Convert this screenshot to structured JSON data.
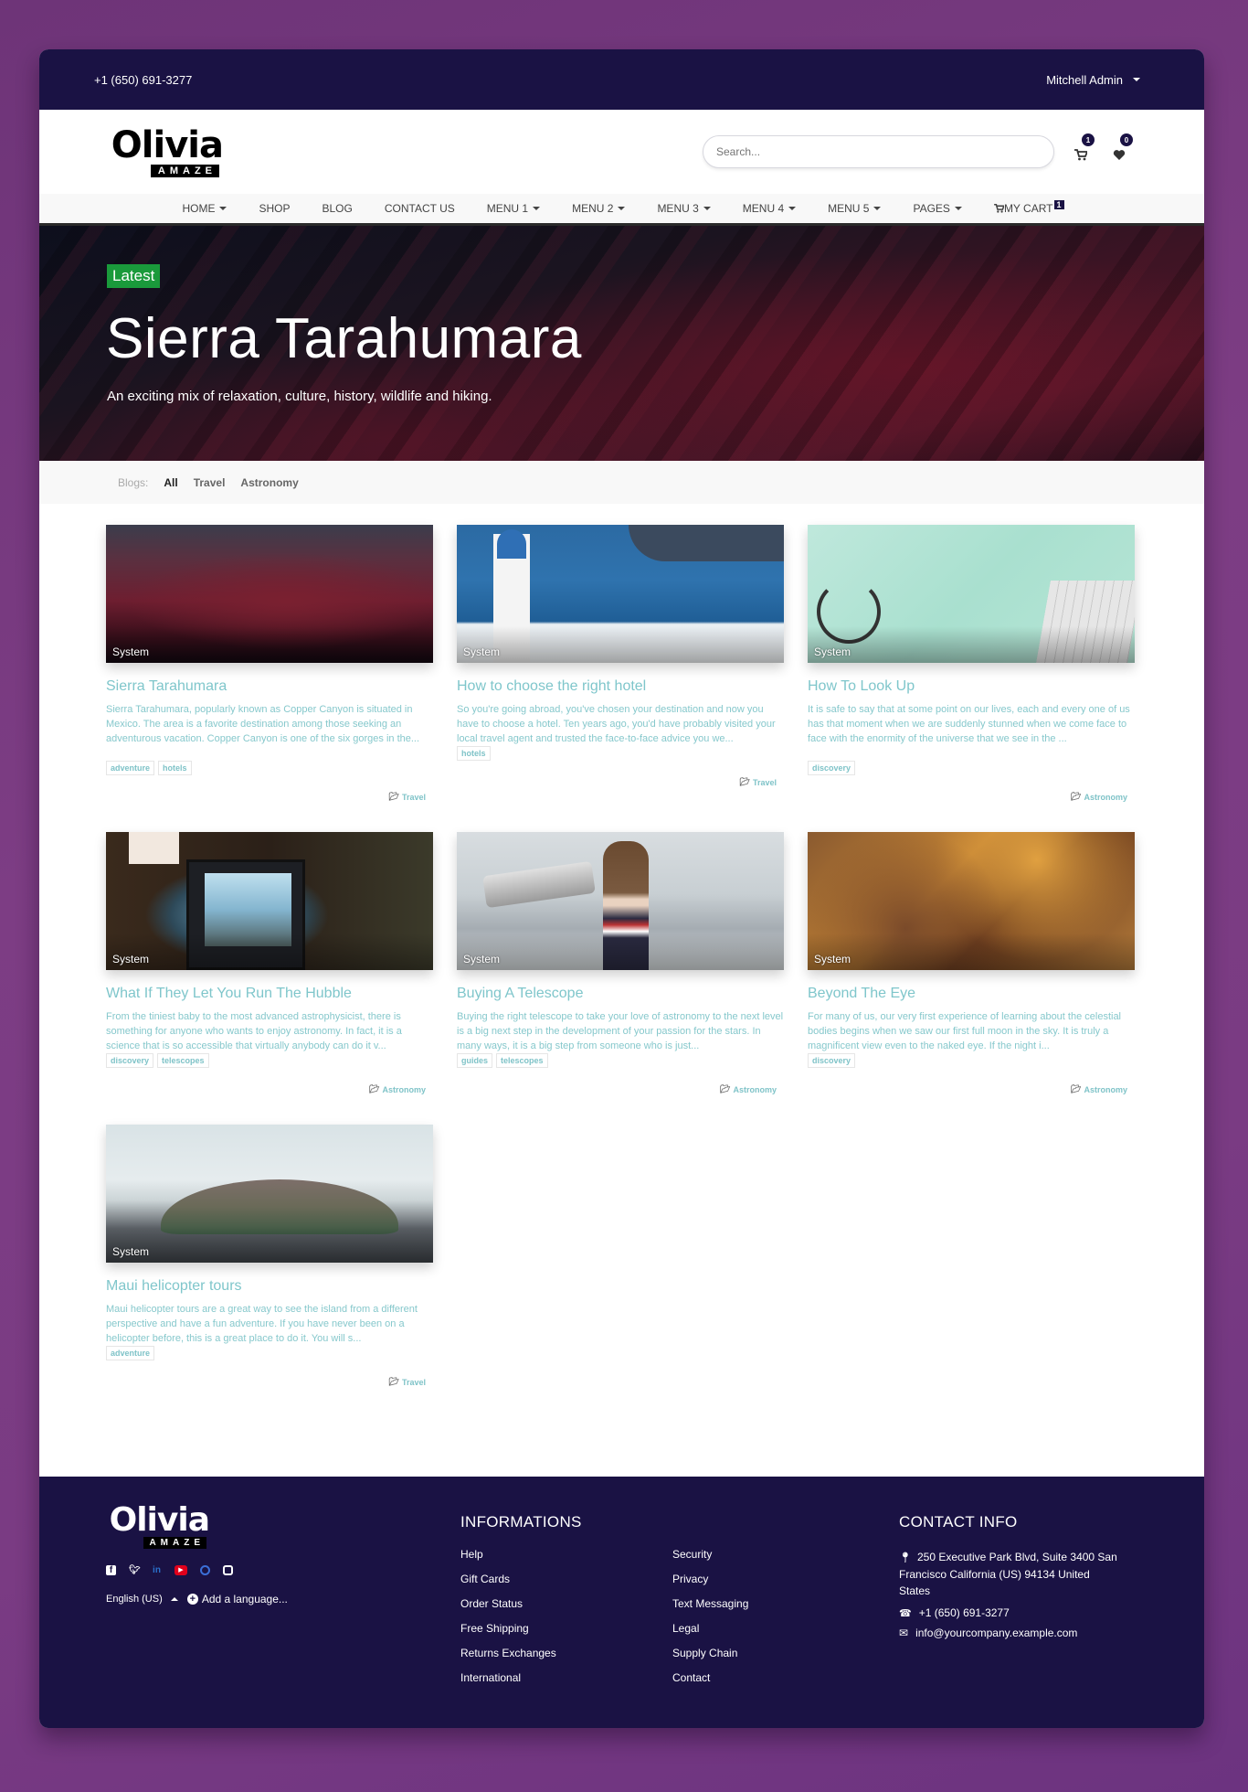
{
  "topbar": {
    "phone": "+1 (650) 691-3277",
    "user": "Mitchell Admin"
  },
  "header": {
    "logo_word": "Olivia",
    "logo_tag": "AMAZE",
    "search_placeholder": "Search...",
    "cart_count": "1",
    "wishlist_count": "0"
  },
  "nav": {
    "items": [
      {
        "label": "HOME",
        "dropdown": true
      },
      {
        "label": "SHOP",
        "dropdown": false
      },
      {
        "label": "BLOG",
        "dropdown": false
      },
      {
        "label": "CONTACT US",
        "dropdown": false
      },
      {
        "label": "MENU 1",
        "dropdown": true
      },
      {
        "label": "MENU 2",
        "dropdown": true
      },
      {
        "label": "MENU 3",
        "dropdown": true
      },
      {
        "label": "MENU 4",
        "dropdown": true
      },
      {
        "label": "MENU 5",
        "dropdown": true
      },
      {
        "label": "PAGES",
        "dropdown": true
      }
    ],
    "cart_label": "MY CART",
    "cart_count": "1"
  },
  "hero": {
    "badge": "Latest",
    "title": "Sierra Tarahumara",
    "subtitle": "An exciting mix of relaxation, culture, history, wildlife and hiking.",
    "badge_color": "#1a9a3b"
  },
  "filters": {
    "label": "Blogs:",
    "items": [
      "All",
      "Travel",
      "Astronomy"
    ],
    "active": "All"
  },
  "posts": [
    {
      "author": "System",
      "title": "Sierra Tarahumara",
      "excerpt": "Sierra Tarahumara, popularly known as Copper Canyon is situated in Mexico. The area is a favorite destination among those seeking an adventurous vacation. Copper Canyon is one of the six gorges in the...",
      "tags": [
        "adventure",
        "hotels"
      ],
      "category": "Travel"
    },
    {
      "author": "System",
      "title": "How to choose the right hotel",
      "excerpt": "So you're going abroad, you've chosen your destination and now you have to choose a hotel. Ten years ago, you'd have probably visited your local travel agent and trusted the face-to-face advice you we...",
      "tags": [
        "hotels"
      ],
      "category": "Travel"
    },
    {
      "author": "System",
      "title": "How To Look Up",
      "excerpt": "It is safe to say that at some point on our lives, each and every one of us has that moment when we are suddenly stunned when we come face to face with the enormity of the universe that we see in the ...",
      "tags": [
        "discovery"
      ],
      "category": "Astronomy"
    },
    {
      "author": "System",
      "title": "What If They Let You Run The Hubble",
      "excerpt": "From the tiniest baby to the most advanced astrophysicist, there is something for anyone who wants to enjoy astronomy. In fact, it is a science that is so accessible that virtually anybody can do it v...",
      "tags": [
        "discovery",
        "telescopes"
      ],
      "category": "Astronomy"
    },
    {
      "author": "System",
      "title": "Buying A Telescope",
      "excerpt": "Buying the right telescope to take your love of astronomy to the next level is a big next step in the development of your passion for the stars. In many ways, it is a big step from someone who is just...",
      "tags": [
        "guides",
        "telescopes"
      ],
      "category": "Astronomy"
    },
    {
      "author": "System",
      "title": "Beyond The Eye",
      "excerpt": "For many of us, our very first experience of learning about the celestial bodies begins when we saw our first full moon in the sky. It is truly a magnificent view even to the naked eye. If the night i...",
      "tags": [
        "discovery"
      ],
      "category": "Astronomy"
    },
    {
      "author": "System",
      "title": "Maui helicopter tours",
      "excerpt": "Maui helicopter tours are a great way to see the island from a different perspective and have a fun adventure. If you have never been on a helicopter before, this is a great place to do it. You will s...",
      "tags": [
        "adventure"
      ],
      "category": "Travel"
    }
  ],
  "footer": {
    "logo_word": "Olivia",
    "logo_tag": "AMAZE",
    "social": [
      {
        "icon": "facebook-icon",
        "glyph": "f",
        "color": "#ffffff"
      },
      {
        "icon": "twitter-icon",
        "glyph": "t",
        "color": "#ffffff"
      },
      {
        "icon": "linkedin-icon",
        "glyph": "in",
        "color": "#2a6fc9"
      },
      {
        "icon": "youtube-icon",
        "glyph": "▶",
        "color": "#e0001b"
      },
      {
        "icon": "github-icon",
        "glyph": "◌",
        "color": "#3b6fd8"
      },
      {
        "icon": "instagram-icon",
        "glyph": "◎",
        "color": "#ffffff"
      }
    ],
    "language": "English (US)",
    "add_language": "Add a language...",
    "info_title": "INFORMATIONS",
    "info_col1": [
      "Help",
      "Gift Cards",
      "Order Status",
      "Free Shipping",
      "Returns Exchanges",
      "International"
    ],
    "info_col2": [
      "Security",
      "Privacy",
      "Text Messaging",
      "Legal",
      "Supply Chain",
      "Contact"
    ],
    "contact_title": "CONTACT INFO",
    "address": "250 Executive Park Blvd, Suite 3400  San Francisco  California (US)  94134 United States",
    "phone": "+1 (650) 691-3277",
    "email": "info@yourcompany.example.com"
  },
  "colors": {
    "dark_navy": "#1a1244",
    "accent_teal": "#7fc6cb",
    "background_purple": "#7d3d84"
  }
}
